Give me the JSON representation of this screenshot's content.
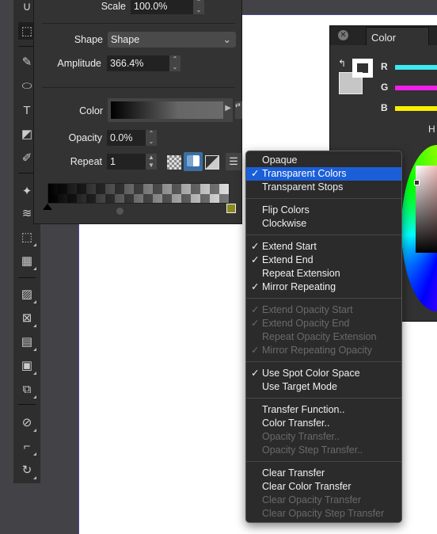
{
  "toolbar": {
    "tools": [
      "magnet-icon",
      "marquee-icon",
      "pen-icon",
      "ellipse-icon",
      "text-icon",
      "shape-select-icon",
      "brush-icon",
      "paint-icon",
      "envelope-icon",
      "lasso-marquee-icon",
      "mesh-icon",
      "gradient-icon",
      "distort-icon",
      "brick-icon",
      "blur-square-icon",
      "shapes-icon",
      "eyedropper-icon",
      "crop-icon",
      "rotate-icon"
    ]
  },
  "panel": {
    "scale_label": "Scale",
    "scale_value": "100.0%",
    "shape_label": "Shape",
    "shape_value": "Shape",
    "amplitude_label": "Amplitude",
    "amplitude_value": "366.4%",
    "color_label": "Color",
    "opacity_label": "Opacity",
    "opacity_value": "0.0%",
    "repeat_label": "Repeat",
    "repeat_value": "1"
  },
  "color_panel": {
    "tab": "Color",
    "channels": [
      "R",
      "G",
      "B"
    ],
    "h_label": "H",
    "colors": {
      "R": "#3ee8f0",
      "G": "#f020e8",
      "B": "#f8ee00"
    }
  },
  "menu": {
    "items": [
      {
        "label": "Opaque",
        "checked": false,
        "disabled": false
      },
      {
        "label": "Transparent Colors",
        "checked": true,
        "disabled": false,
        "highlighted": true
      },
      {
        "label": "Transparent Stops",
        "checked": false,
        "disabled": false
      },
      {
        "sep": true
      },
      {
        "label": "Flip Colors",
        "checked": false,
        "disabled": false
      },
      {
        "label": "Clockwise",
        "checked": false,
        "disabled": false
      },
      {
        "sep": true
      },
      {
        "label": "Extend Start",
        "checked": true,
        "disabled": false
      },
      {
        "label": "Extend End",
        "checked": true,
        "disabled": false
      },
      {
        "label": "Repeat Extension",
        "checked": false,
        "disabled": false
      },
      {
        "label": "Mirror Repeating",
        "checked": true,
        "disabled": false
      },
      {
        "sep": true
      },
      {
        "label": "Extend Opacity Start",
        "checked": true,
        "disabled": true
      },
      {
        "label": "Extend Opacity End",
        "checked": true,
        "disabled": true
      },
      {
        "label": "Repeat Opacity Extension",
        "checked": false,
        "disabled": true
      },
      {
        "label": "Mirror Repeating Opacity",
        "checked": true,
        "disabled": true
      },
      {
        "sep": true
      },
      {
        "label": "Use Spot Color Space",
        "checked": true,
        "disabled": false
      },
      {
        "label": "Use Target Mode",
        "checked": false,
        "disabled": false
      },
      {
        "sep": true
      },
      {
        "label": "Transfer Function..",
        "checked": false,
        "disabled": false
      },
      {
        "label": "Color Transfer..",
        "checked": false,
        "disabled": false
      },
      {
        "label": "Opacity Transfer..",
        "checked": false,
        "disabled": true
      },
      {
        "label": "Opacity Step Transfer..",
        "checked": false,
        "disabled": true
      },
      {
        "sep": true
      },
      {
        "label": "Clear Transfer",
        "checked": false,
        "disabled": false
      },
      {
        "label": "Clear Color Transfer",
        "checked": false,
        "disabled": false
      },
      {
        "label": "Clear Opacity Transfer",
        "checked": false,
        "disabled": true
      },
      {
        "label": "Clear Opacity Step Transfer",
        "checked": false,
        "disabled": true
      }
    ],
    "check_glyph": "✓"
  }
}
